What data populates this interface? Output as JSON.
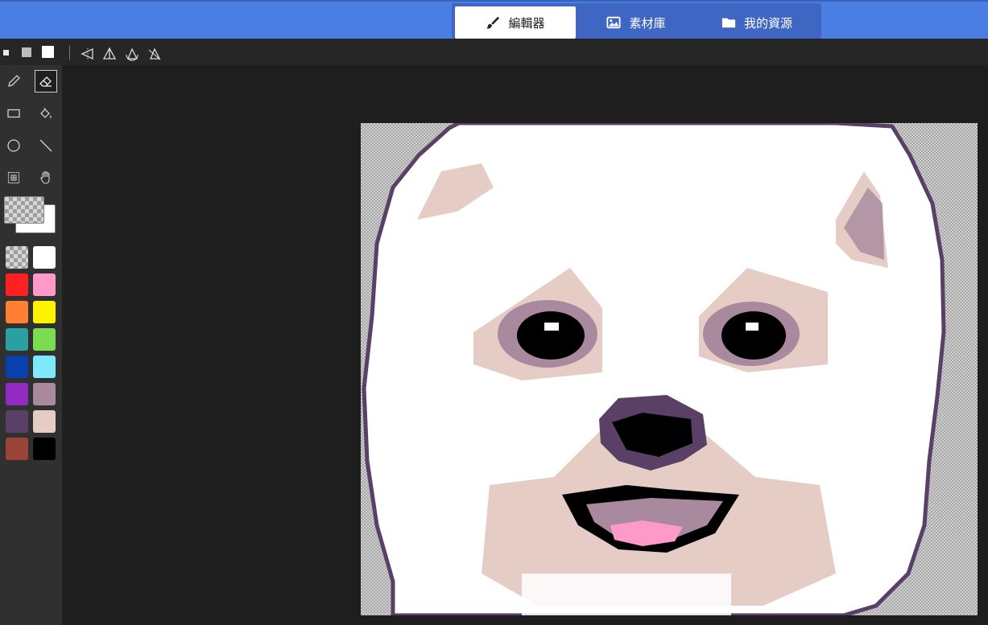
{
  "tabs": [
    {
      "label": "編輯器",
      "icon": "brush-icon",
      "active": true
    },
    {
      "label": "素材庫",
      "icon": "image-icon",
      "active": false
    },
    {
      "label": "我的資源",
      "icon": "folder-icon",
      "active": false
    }
  ],
  "brush_sizes": [
    "small",
    "medium",
    "large"
  ],
  "symmetry_modes": [
    "symmetry-vertical-icon",
    "symmetry-horizontal-icon",
    "symmetry-rotate-icon",
    "symmetry-diagonal-icon"
  ],
  "tools": [
    {
      "name": "pencil-icon",
      "active": false
    },
    {
      "name": "eraser-icon",
      "active": true
    },
    {
      "name": "rectangle-icon",
      "active": false
    },
    {
      "name": "fill-bucket-icon",
      "active": false
    },
    {
      "name": "circle-icon",
      "active": false
    },
    {
      "name": "line-icon",
      "active": false
    },
    {
      "name": "selection-icon",
      "active": false
    },
    {
      "name": "hand-icon",
      "active": false
    }
  ],
  "current_colors": {
    "primary": "transparent",
    "secondary": "#ffffff"
  },
  "palette": [
    "transparent",
    "#ffffff",
    "#ff2121",
    "#ff9ac8",
    "#ff7f33",
    "#fff200",
    "#2aa0a3",
    "#7ddb52",
    "#0a3fb0",
    "#7fe8fa",
    "#932ac2",
    "#a8899e",
    "#5a3f66",
    "#e5cdc5",
    "#9a4338",
    "#000000"
  ],
  "colors": {
    "topbar": "#4a7ee3",
    "tab_group": "#3e66c2",
    "background": "#1e1e1e",
    "toolbar": "#303030"
  }
}
